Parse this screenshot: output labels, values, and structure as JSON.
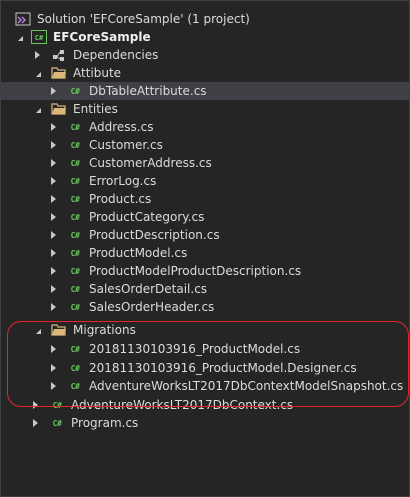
{
  "solution": {
    "label": "Solution 'EFCoreSample' (1 project)",
    "icon": "solution-icon"
  },
  "project": {
    "label": "EFCoreSample",
    "icon": "csharp-project-icon"
  },
  "dependencies": {
    "label": "Dependencies",
    "icon": "dependencies-icon"
  },
  "folders": {
    "attribute": {
      "label": "Attibute",
      "files": [
        {
          "label": "DbTableAttribute.cs"
        }
      ]
    },
    "entities": {
      "label": "Entities",
      "files": [
        {
          "label": "Address.cs"
        },
        {
          "label": "Customer.cs"
        },
        {
          "label": "CustomerAddress.cs"
        },
        {
          "label": "ErrorLog.cs"
        },
        {
          "label": "Product.cs"
        },
        {
          "label": "ProductCategory.cs"
        },
        {
          "label": "ProductDescription.cs"
        },
        {
          "label": "ProductModel.cs"
        },
        {
          "label": "ProductModelProductDescription.cs"
        },
        {
          "label": "SalesOrderDetail.cs"
        },
        {
          "label": "SalesOrderHeader.cs"
        }
      ]
    },
    "migrations": {
      "label": "Migrations",
      "files": [
        {
          "label": "20181130103916_ProductModel.cs"
        },
        {
          "label": "20181130103916_ProductModel.Designer.cs"
        },
        {
          "label": "AdventureWorksLT2017DbContextModelSnapshot.cs"
        }
      ]
    }
  },
  "root_files": [
    {
      "label": "AdventureWorksLT2017DbContext.cs"
    },
    {
      "label": "Program.cs"
    }
  ],
  "cs_icon_text": "C#",
  "colors": {
    "background": "#252526",
    "text": "#dcdcdc",
    "folder": "#dcb67a",
    "csharp": "#68c85c",
    "highlight_border": "#e8252a",
    "selected_row": "#3f3f46"
  }
}
